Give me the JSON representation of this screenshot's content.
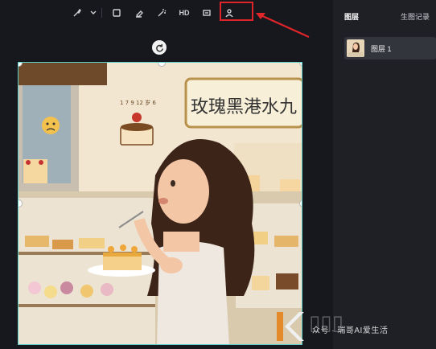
{
  "toolbar": {
    "items": [
      {
        "name": "brush-icon"
      },
      {
        "name": "chevron-down-icon"
      },
      {
        "name": "crop-icon"
      },
      {
        "name": "eraser-icon"
      },
      {
        "name": "magic-wand-icon"
      },
      {
        "name": "hd-button",
        "label": "HD"
      },
      {
        "name": "expand-icon"
      },
      {
        "name": "cutout-person-icon"
      }
    ]
  },
  "panel": {
    "tab_layers": "图层",
    "tab_history": "生图记录",
    "layer_name": "图层 1"
  },
  "canvas": {
    "shop_sign": "玫瑰黑港水九",
    "cake_caption": "1 7 9 12 岁 6"
  },
  "watermark": {
    "text": "众号 · 瑞哥AI爱生活"
  },
  "colors": {
    "highlight": "#e0252a",
    "selection": "#5fd0c8"
  }
}
